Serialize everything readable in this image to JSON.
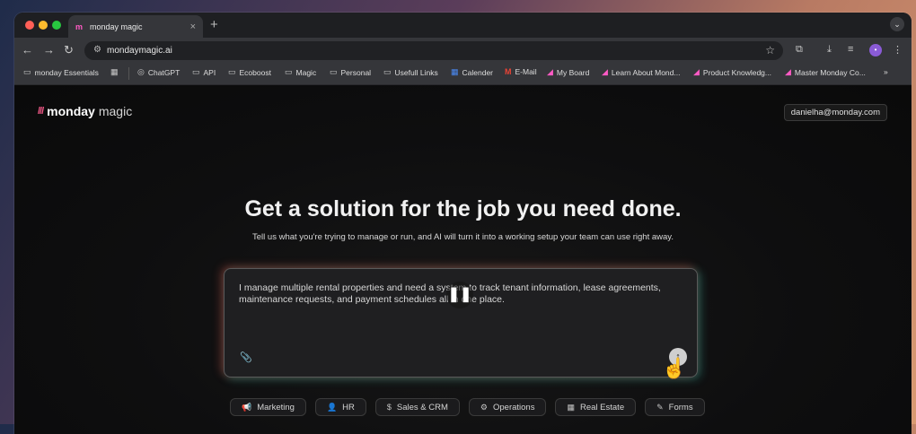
{
  "browser": {
    "tab": {
      "favicon": "m",
      "title": "monday magic",
      "close": "×"
    },
    "new_tab": "+",
    "tab_menu": "⌄",
    "nav": {
      "back": "←",
      "forward": "→",
      "reload": "↻"
    },
    "url": "mondaymagic.ai",
    "profile_initial": "•",
    "bookmarks": [
      {
        "icon": "▭",
        "label": "monday Essentials"
      },
      {
        "icon": "◎",
        "label": "ChatGPT"
      },
      {
        "icon": "▭",
        "label": "API"
      },
      {
        "icon": "▭",
        "label": "Ecoboost"
      },
      {
        "icon": "▭",
        "label": "Magic"
      },
      {
        "icon": "▭",
        "label": "Personal"
      },
      {
        "icon": "▭",
        "label": "Usefull Links"
      },
      {
        "icon": "▦",
        "label": "Calender"
      },
      {
        "icon": "M",
        "label": "E-Mail"
      },
      {
        "icon": "◢",
        "label": "My Board"
      },
      {
        "icon": "◢",
        "label": "Learn About Mond..."
      },
      {
        "icon": "◢",
        "label": "Product Knowledg..."
      },
      {
        "icon": "◢",
        "label": "Master Monday Co..."
      }
    ],
    "bookmarks_overflow": "»"
  },
  "page": {
    "logo_text": "monday",
    "logo_sub": "magic",
    "user_email": "danielha@monday.com",
    "headline": "Get a solution for the job you need done.",
    "subheadline": "Tell us what you're trying to manage or run, and AI will turn it into a working setup your team can use right away.",
    "prompt_text": "I manage multiple rental properties and need a system to track tenant information, lease agreements, maintenance requests, and payment schedules all in one place.",
    "categories": [
      {
        "icon": "📢",
        "label": "Marketing"
      },
      {
        "icon": "👤",
        "label": "HR"
      },
      {
        "icon": "$",
        "label": "Sales & CRM"
      },
      {
        "icon": "⚙",
        "label": "Operations"
      },
      {
        "icon": "▦",
        "label": "Real Estate"
      },
      {
        "icon": "✎",
        "label": "Forms"
      }
    ]
  },
  "colors": {
    "brand_pink": "#f65a8a",
    "gradient_red": "#f45c4c",
    "gradient_teal": "#3ad2be"
  }
}
